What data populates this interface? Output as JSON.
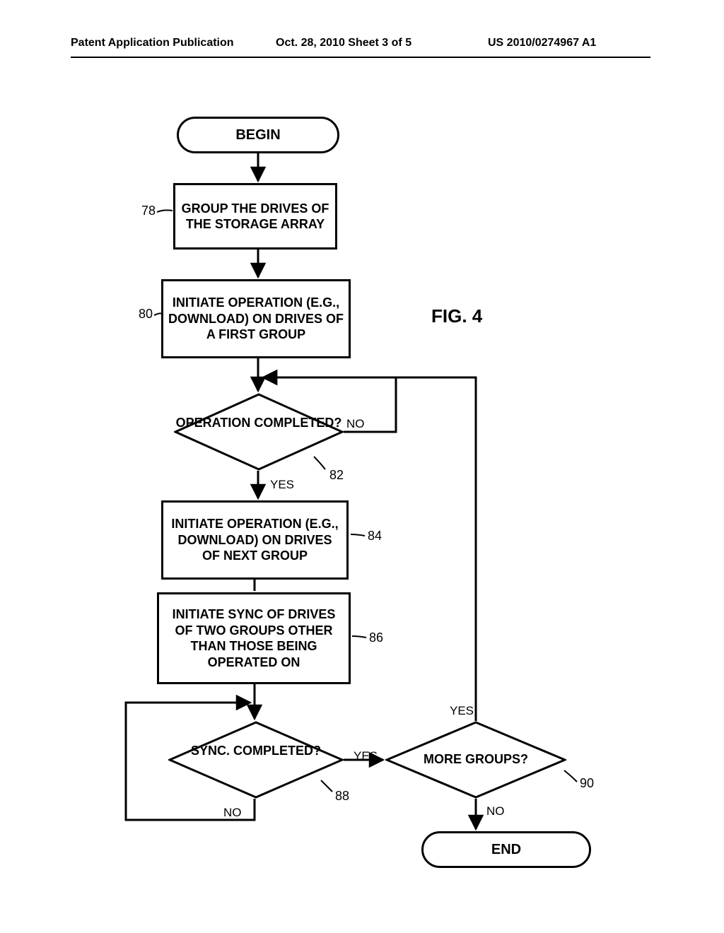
{
  "header": {
    "left": "Patent Application Publication",
    "center": "Oct. 28, 2010   Sheet 3 of 5",
    "right": "US 2010/0274967 A1"
  },
  "figure_label": "FIG. 4",
  "nodes": {
    "begin": "BEGIN",
    "step78": "GROUP THE DRIVES OF THE STORAGE ARRAY",
    "step80": "INITIATE OPERATION (E.G., DOWNLOAD) ON DRIVES OF A FIRST GROUP",
    "dec82": "OPERATION COMPLETED?",
    "step84": "INITIATE OPERATION (E.G., DOWNLOAD) ON DRIVES OF NEXT GROUP",
    "step86": "INITIATE SYNC OF DRIVES OF TWO GROUPS OTHER THAN THOSE BEING OPERATED ON",
    "dec88": "SYNC. COMPLETED?",
    "dec90": "MORE GROUPS?",
    "end": "END"
  },
  "refs": {
    "r78": "78",
    "r80": "80",
    "r82": "82",
    "r84": "84",
    "r86": "86",
    "r88": "88",
    "r90": "90"
  },
  "edges": {
    "yes82": "YES",
    "no82": "NO",
    "yes88": "YES",
    "no88": "NO",
    "yes90": "YES",
    "no90": "NO"
  }
}
